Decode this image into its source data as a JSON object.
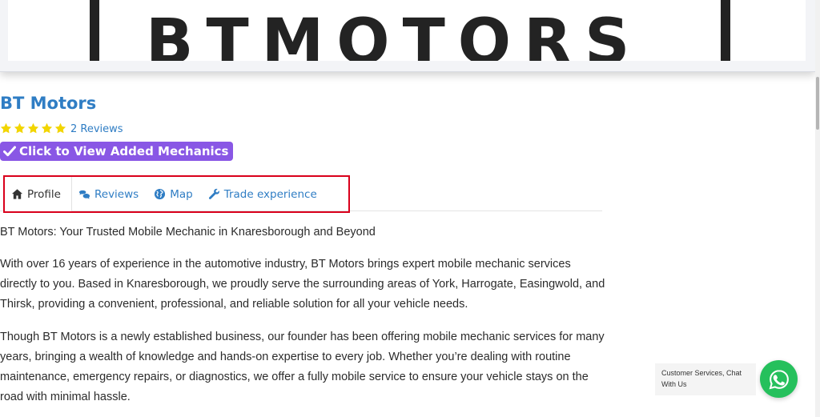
{
  "hero": {
    "logo_text": "BTMOTORS"
  },
  "business": {
    "name": "BT Motors",
    "rating": 5,
    "rating_max": 5,
    "reviews_label": "2 Reviews",
    "mechanics_button": "Click to View Added Mechanics"
  },
  "tabs": [
    {
      "label": "Profile",
      "icon": "home-icon",
      "active": true
    },
    {
      "label": "Reviews",
      "icon": "comments-icon",
      "active": false
    },
    {
      "label": "Map",
      "icon": "globe-icon",
      "active": false
    },
    {
      "label": "Trade experience",
      "icon": "wrench-icon",
      "active": false
    }
  ],
  "profile": {
    "headline": "BT Motors: Your Trusted Mobile Mechanic in Knaresborough and Beyond",
    "paragraph1": "With over 16 years of experience in the automotive industry, BT Motors brings expert mobile mechanic services directly to you. Based in Knaresborough, we proudly serve the surrounding areas of York, Harrogate, Easingwold, and Thirsk, providing a convenient, professional, and reliable solution for all your vehicle needs.",
    "paragraph2": "Though BT Motors is a newly established business, our founder has been offering mobile mechanic services for many years, bringing a wealth of knowledge and hands-on expertise to every job. Whether you’re dealing with routine maintenance, emergency repairs, or diagnostics, we offer a fully mobile service to ensure your vehicle stays on the road with minimal hassle."
  },
  "chat": {
    "label": "Customer Services, Chat With Us",
    "icon": "whatsapp-icon"
  },
  "colors": {
    "link": "#2f7dc4",
    "badge": "#8957e5",
    "star": "#f2d500",
    "tab_border": "#d9001b",
    "whatsapp": "#25c05c"
  }
}
